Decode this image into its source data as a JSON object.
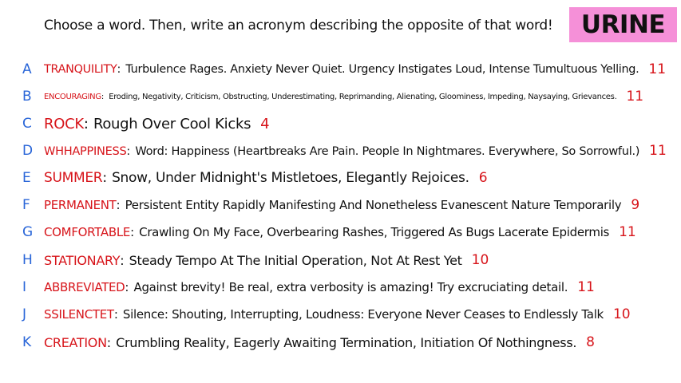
{
  "prompt": "Choose a word. Then, write an acronym describing the opposite of that word!",
  "answer_word": "URINE",
  "colors": {
    "letter": "#2a66d8",
    "word": "#d7141a",
    "count": "#d7141a",
    "answer_bg": "#f590d8"
  },
  "rows": [
    {
      "letter": "A",
      "word": "TRANQUILITY",
      "acronym": "Turbulence Rages. Anxiety Never Quiet. Urgency Instigates Loud, Intense Tumultuous Yelling.",
      "count": "11"
    },
    {
      "letter": "B",
      "word": "ENCOURAGING",
      "acronym": "Eroding, Negativity, Criticism, Obstructing, Underestimating, Reprimanding, Alienating, Gloominess, Impeding, Naysaying, Grievances.",
      "count": "11"
    },
    {
      "letter": "C",
      "word": "ROCK",
      "acronym": "Rough Over Cool Kicks",
      "count": "4"
    },
    {
      "letter": "D",
      "word": "WHHAPPINESS",
      "acronym": "Word: Happiness (Heartbreaks Are Pain. People In Nightmares. Everywhere, So Sorrowful.)",
      "count": "11"
    },
    {
      "letter": "E",
      "word": "SUMMER",
      "acronym": "Snow, Under Midnight's Mistletoes, Elegantly Rejoices.",
      "count": "6"
    },
    {
      "letter": "F",
      "word": "PERMANENT",
      "acronym": "Persistent Entity Rapidly Manifesting And Nonetheless Evanescent Nature Temporarily",
      "count": "9"
    },
    {
      "letter": "G",
      "word": "COMFORTABLE",
      "acronym": "Crawling On My Face, Overbearing Rashes, Triggered As Bugs Lacerate Epidermis",
      "count": "11"
    },
    {
      "letter": "H",
      "word": "STATIONARY",
      "acronym": "Steady Tempo At The Initial Operation, Not At Rest Yet",
      "count": "10"
    },
    {
      "letter": "I",
      "word": "ABBREVIATED",
      "acronym": "Against brevity! Be real, extra verbosity is amazing! Try excruciating detail.",
      "count": "11"
    },
    {
      "letter": "J",
      "word": "SSILENCTET",
      "acronym": "Silence: Shouting, Interrupting, Loudness: Everyone Never Ceases to Endlessly Talk",
      "count": "10"
    },
    {
      "letter": "K",
      "word": "CREATION",
      "acronym": "Crumbling Reality, Eagerly Awaiting Termination, Initiation Of Nothingness.",
      "count": "8"
    }
  ]
}
